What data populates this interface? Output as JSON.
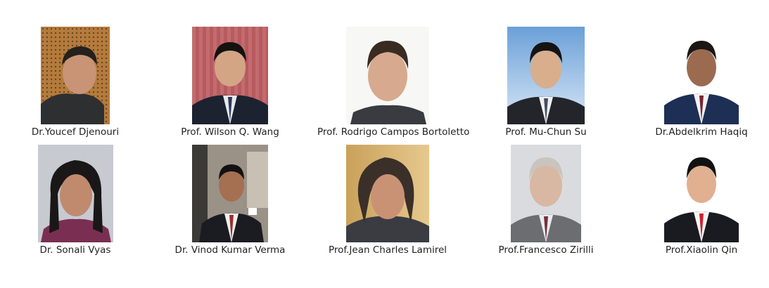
{
  "people": [
    {
      "name": "Dr.Youcef Djenouri",
      "photo_icon": "portrait-icon"
    },
    {
      "name": "Prof. Wilson Q. Wang",
      "photo_icon": "portrait-icon"
    },
    {
      "name": "Prof. Rodrigo Campos Bortoletto",
      "photo_icon": "portrait-icon"
    },
    {
      "name": "Prof. Mu-Chun Su",
      "photo_icon": "portrait-icon"
    },
    {
      "name": "Dr.Abdelkrim Haqiq",
      "photo_icon": "portrait-icon"
    },
    {
      "name": "Dr. Sonali Vyas",
      "photo_icon": "portrait-icon"
    },
    {
      "name": "Dr. Vinod Kumar Verma",
      "photo_icon": "portrait-icon"
    },
    {
      "name": "Prof.Jean Charles Lamirel",
      "photo_icon": "portrait-icon"
    },
    {
      "name": "Prof.Francesco Zirilli",
      "photo_icon": "portrait-icon"
    },
    {
      "name": "Prof.Xiaolin Qin",
      "photo_icon": "portrait-icon"
    }
  ]
}
